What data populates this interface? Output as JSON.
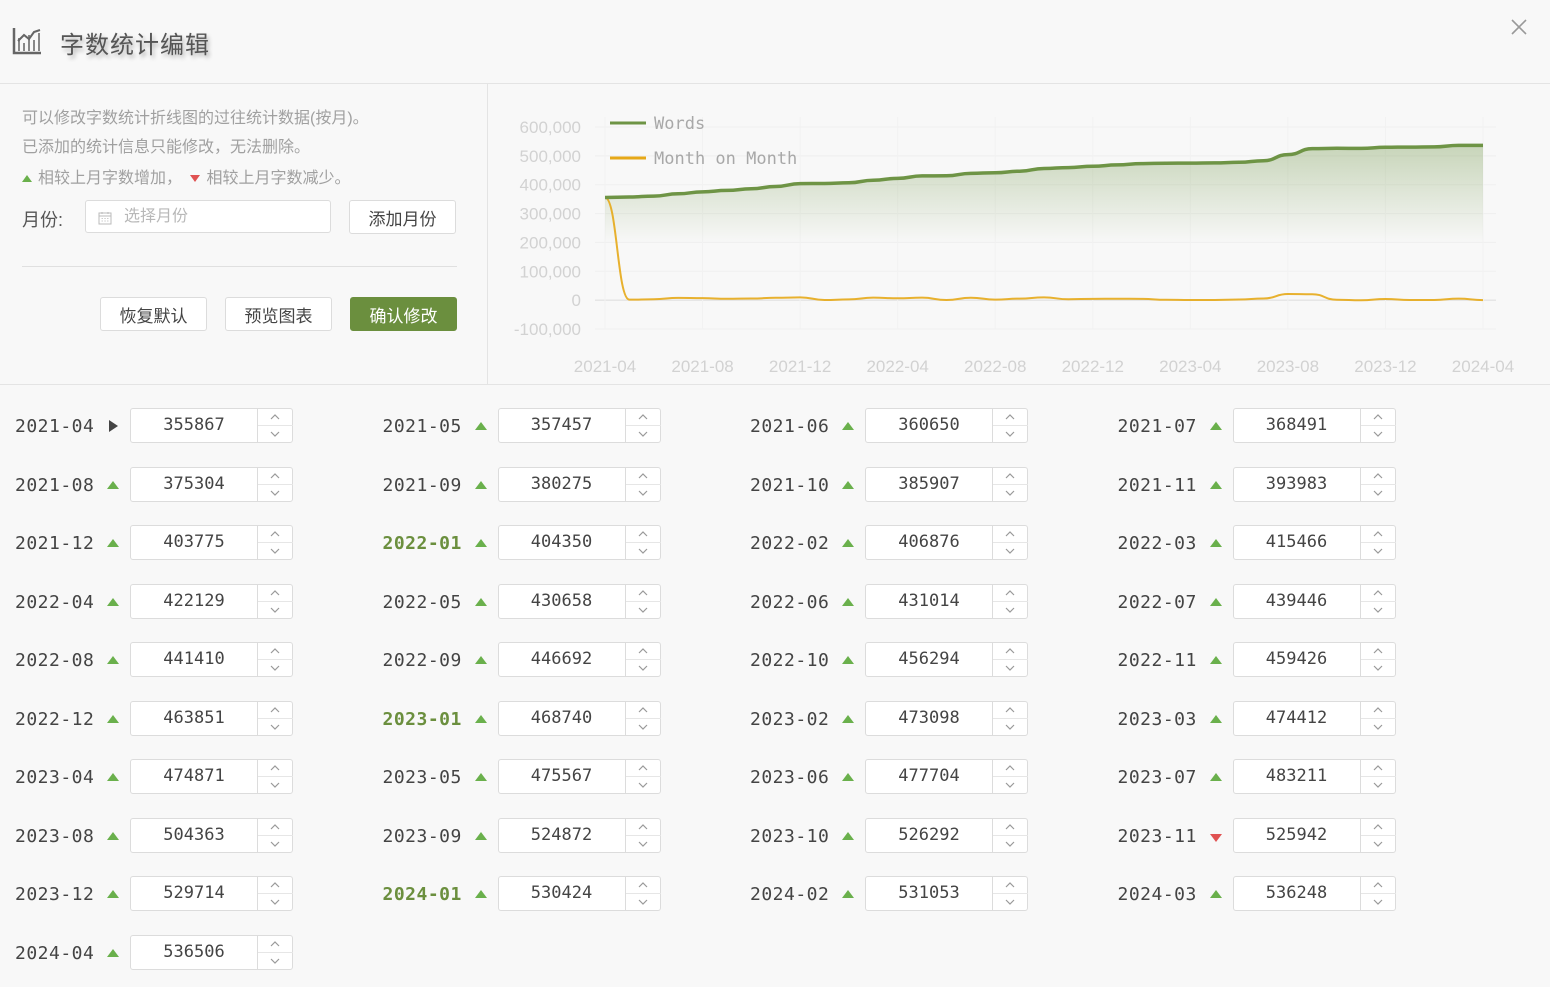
{
  "header": {
    "title": "字数统计编辑"
  },
  "panel": {
    "desc_line1": "可以修改字数统计折线图的过往统计数据(按月)。",
    "desc_line2": "已添加的统计信息只能修改，无法删除。",
    "legend_up_text": "相较上月字数增加，",
    "legend_down_text": "相较上月字数减少。",
    "month_label": "月份:",
    "month_placeholder": "选择月份",
    "add_month": "添加月份",
    "restore_default": "恢复默认",
    "preview_chart": "预览图表",
    "confirm": "确认修改"
  },
  "colors": {
    "accent": "#6b8f3e",
    "words": "#6e9445",
    "mom": "#e6a817",
    "up": "#6ab04c",
    "down": "#e05252"
  },
  "chart_data": {
    "type": "line",
    "x": [
      "2021-04",
      "2021-05",
      "2021-06",
      "2021-07",
      "2021-08",
      "2021-09",
      "2021-10",
      "2021-11",
      "2021-12",
      "2022-01",
      "2022-02",
      "2022-03",
      "2022-04",
      "2022-05",
      "2022-06",
      "2022-07",
      "2022-08",
      "2022-09",
      "2022-10",
      "2022-11",
      "2022-12",
      "2023-01",
      "2023-02",
      "2023-03",
      "2023-04",
      "2023-05",
      "2023-06",
      "2023-07",
      "2023-08",
      "2023-09",
      "2023-10",
      "2023-11",
      "2023-12",
      "2024-01",
      "2024-02",
      "2024-03",
      "2024-04"
    ],
    "xticks": [
      "2021-04",
      "2021-08",
      "2021-12",
      "2022-04",
      "2022-08",
      "2022-12",
      "2023-04",
      "2023-08",
      "2023-12",
      "2024-04"
    ],
    "yticks": [
      "600,000",
      "500,000",
      "400,000",
      "300,000",
      "200,000",
      "100,000",
      "0",
      "-100,000"
    ],
    "ylim": [
      -100000,
      600000
    ],
    "legend_position": "top-left",
    "series": [
      {
        "name": "Words",
        "values": [
          355867,
          357457,
          360650,
          368491,
          375304,
          380275,
          385907,
          393983,
          403775,
          404350,
          406876,
          415466,
          422129,
          430658,
          431014,
          439446,
          441410,
          446692,
          456294,
          459426,
          463851,
          468740,
          473098,
          474412,
          474871,
          475567,
          477704,
          483211,
          504363,
          524872,
          526292,
          525942,
          529714,
          530424,
          531053,
          536248,
          536506
        ]
      },
      {
        "name": "Month on Month",
        "values": [
          355867,
          1590,
          3193,
          7841,
          6813,
          4971,
          5632,
          8076,
          9792,
          575,
          2526,
          8590,
          6663,
          8529,
          356,
          8432,
          1964,
          5282,
          9602,
          3132,
          4425,
          4889,
          4358,
          1314,
          459,
          696,
          2137,
          5507,
          21152,
          20509,
          1420,
          -350,
          3772,
          710,
          629,
          5195,
          258
        ]
      }
    ]
  },
  "entries": [
    {
      "month": "2021-04",
      "value": "355867",
      "trend": "flat"
    },
    {
      "month": "2021-05",
      "value": "357457",
      "trend": "up"
    },
    {
      "month": "2021-06",
      "value": "360650",
      "trend": "up"
    },
    {
      "month": "2021-07",
      "value": "368491",
      "trend": "up"
    },
    {
      "month": "2021-08",
      "value": "375304",
      "trend": "up"
    },
    {
      "month": "2021-09",
      "value": "380275",
      "trend": "up"
    },
    {
      "month": "2021-10",
      "value": "385907",
      "trend": "up"
    },
    {
      "month": "2021-11",
      "value": "393983",
      "trend": "up"
    },
    {
      "month": "2021-12",
      "value": "403775",
      "trend": "up"
    },
    {
      "month": "2022-01",
      "value": "404350",
      "trend": "up"
    },
    {
      "month": "2022-02",
      "value": "406876",
      "trend": "up"
    },
    {
      "month": "2022-03",
      "value": "415466",
      "trend": "up"
    },
    {
      "month": "2022-04",
      "value": "422129",
      "trend": "up"
    },
    {
      "month": "2022-05",
      "value": "430658",
      "trend": "up"
    },
    {
      "month": "2022-06",
      "value": "431014",
      "trend": "up"
    },
    {
      "month": "2022-07",
      "value": "439446",
      "trend": "up"
    },
    {
      "month": "2022-08",
      "value": "441410",
      "trend": "up"
    },
    {
      "month": "2022-09",
      "value": "446692",
      "trend": "up"
    },
    {
      "month": "2022-10",
      "value": "456294",
      "trend": "up"
    },
    {
      "month": "2022-11",
      "value": "459426",
      "trend": "up"
    },
    {
      "month": "2022-12",
      "value": "463851",
      "trend": "up"
    },
    {
      "month": "2023-01",
      "value": "468740",
      "trend": "up"
    },
    {
      "month": "2023-02",
      "value": "473098",
      "trend": "up"
    },
    {
      "month": "2023-03",
      "value": "474412",
      "trend": "up"
    },
    {
      "month": "2023-04",
      "value": "474871",
      "trend": "up"
    },
    {
      "month": "2023-05",
      "value": "475567",
      "trend": "up"
    },
    {
      "month": "2023-06",
      "value": "477704",
      "trend": "up"
    },
    {
      "month": "2023-07",
      "value": "483211",
      "trend": "up"
    },
    {
      "month": "2023-08",
      "value": "504363",
      "trend": "up"
    },
    {
      "month": "2023-09",
      "value": "524872",
      "trend": "up"
    },
    {
      "month": "2023-10",
      "value": "526292",
      "trend": "up"
    },
    {
      "month": "2023-11",
      "value": "525942",
      "trend": "down"
    },
    {
      "month": "2023-12",
      "value": "529714",
      "trend": "up"
    },
    {
      "month": "2024-01",
      "value": "530424",
      "trend": "up"
    },
    {
      "month": "2024-02",
      "value": "531053",
      "trend": "up"
    },
    {
      "month": "2024-03",
      "value": "536248",
      "trend": "up"
    },
    {
      "month": "2024-04",
      "value": "536506",
      "trend": "up"
    }
  ]
}
